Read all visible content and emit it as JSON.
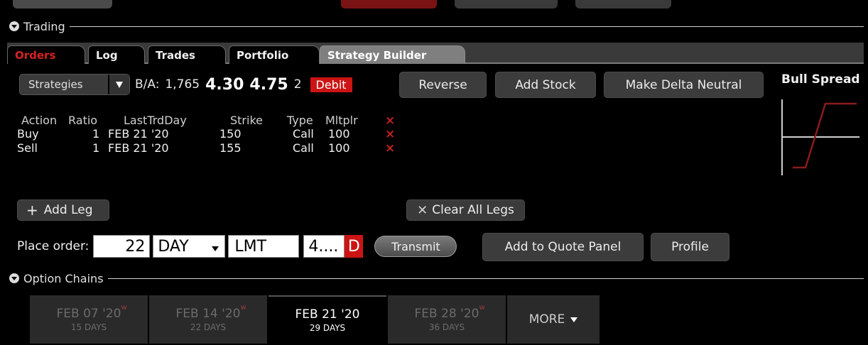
{
  "sections": {
    "trading": "Trading",
    "option_chains": "Option Chains"
  },
  "tabs": [
    "Orders",
    "Log",
    "Trades",
    "Portfolio",
    "Strategy Builder"
  ],
  "strategy": {
    "dropdown_label": "Strategies",
    "ba_label": "B/A:",
    "size": "1,765",
    "bid": "4.30",
    "ask": "4.75",
    "qty": "2",
    "side_badge": "Debit",
    "buttons": {
      "reverse": "Reverse",
      "add_stock": "Add Stock",
      "make_delta_neutral": "Make Delta Neutral"
    },
    "chart_title": "Bull Spread"
  },
  "legs": {
    "headers": [
      "Action",
      "Ratio",
      "LastTrdDay",
      "Strike",
      "Type",
      "Mltplr"
    ],
    "rows": [
      {
        "action": "Buy",
        "ratio": "1",
        "last_trd_day": "FEB 21 '20",
        "strike": "150",
        "type": "Call",
        "mltplr": "100"
      },
      {
        "action": "Sell",
        "ratio": "1",
        "last_trd_day": "FEB 21 '20",
        "strike": "155",
        "type": "Call",
        "mltplr": "100"
      }
    ],
    "delete_icon": "×"
  },
  "actions": {
    "add_leg": "Add Leg",
    "clear_all_legs": "Clear All Legs"
  },
  "order": {
    "label": "Place order:",
    "quantity": "22",
    "tif": "DAY",
    "order_type": "LMT",
    "price": "4....",
    "price_side": "D",
    "transmit": "Transmit",
    "add_to_quote_panel": "Add to Quote Panel",
    "profile": "Profile"
  },
  "option_chains": [
    {
      "date": "FEB 07 '20",
      "marker": "w",
      "days": "15 DAYS",
      "active": false
    },
    {
      "date": "FEB 14 '20",
      "marker": "w",
      "days": "22 DAYS",
      "active": false
    },
    {
      "date": "FEB 21 '20",
      "marker": "",
      "days": "29 DAYS",
      "active": true
    },
    {
      "date": "FEB 28 '20",
      "marker": "w",
      "days": "36 DAYS",
      "active": false
    }
  ],
  "more": "MORE",
  "colors": {
    "accent_red": "#cc1414",
    "tab_active": "#7f7f7f",
    "chart_line": "#8a1c1c"
  }
}
